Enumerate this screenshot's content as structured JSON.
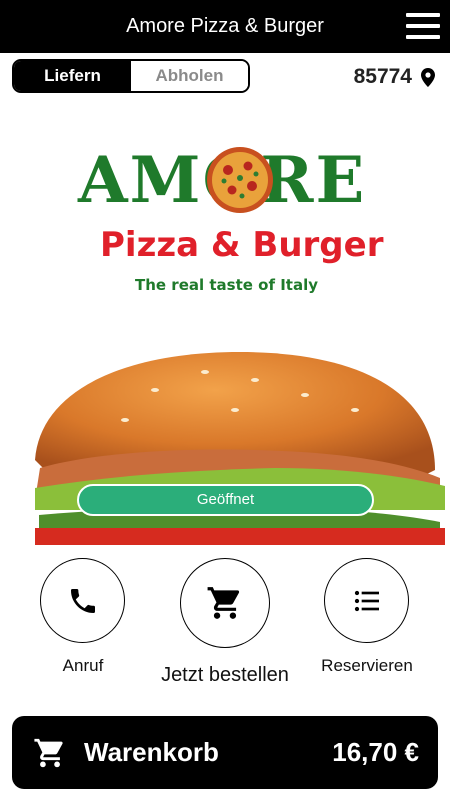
{
  "header": {
    "title": "Amore Pizza & Burger",
    "menu_icon": "hamburger-menu-icon"
  },
  "order_mode": {
    "options": [
      "Liefern",
      "Abholen"
    ],
    "selected": "Liefern"
  },
  "location": {
    "zip": "85774",
    "icon": "location-pin-icon"
  },
  "logo": {
    "word": "AMORE",
    "subtitle": "Pizza & Burger",
    "tagline": "The real taste of Italy"
  },
  "status": {
    "label": "Geöffnet"
  },
  "actions": [
    {
      "label": "Anruf",
      "icon": "phone-icon"
    },
    {
      "label": "Jetzt bestellen",
      "icon": "shopping-cart-icon"
    },
    {
      "label": "Reservieren",
      "icon": "list-icon"
    }
  ],
  "cart": {
    "label": "Warenkorb",
    "total": "16,70 €",
    "icon": "shopping-cart-icon"
  },
  "colors": {
    "bar": "#000000",
    "status": "#2bae7a",
    "logo_green": "#1f7a2b",
    "logo_red": "#e0202a"
  }
}
